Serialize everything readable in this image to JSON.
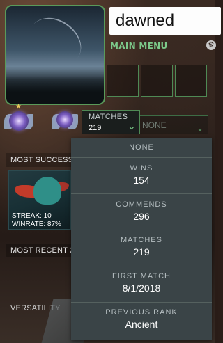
{
  "player": {
    "name": "dawned"
  },
  "nav": {
    "main_menu_label": "MAIN MENU",
    "settings_icon": "gear-icon"
  },
  "stat_selector": {
    "label": "MATCHES",
    "value": "219"
  },
  "secondary_selector": {
    "label": "NONE"
  },
  "sections": {
    "most_successful": "MOST SUCCESSF",
    "most_recent": "MOST RECENT 2",
    "versatility": "VERSATILITY"
  },
  "hero_card": {
    "streak": "STREAK: 10",
    "winrate": "WINRATE: 87%"
  },
  "dropdown_options": [
    {
      "key": "NONE",
      "value": ""
    },
    {
      "key": "WINS",
      "value": "154"
    },
    {
      "key": "COMMENDS",
      "value": "296"
    },
    {
      "key": "MATCHES",
      "value": "219"
    },
    {
      "key": "FIRST MATCH",
      "value": "8/1/2018"
    },
    {
      "key": "PREVIOUS RANK",
      "value": "Ancient"
    }
  ],
  "colors": {
    "accent": "#7cc98a",
    "dropdown_bg": "#3a4447",
    "border": "#4f8a55"
  }
}
